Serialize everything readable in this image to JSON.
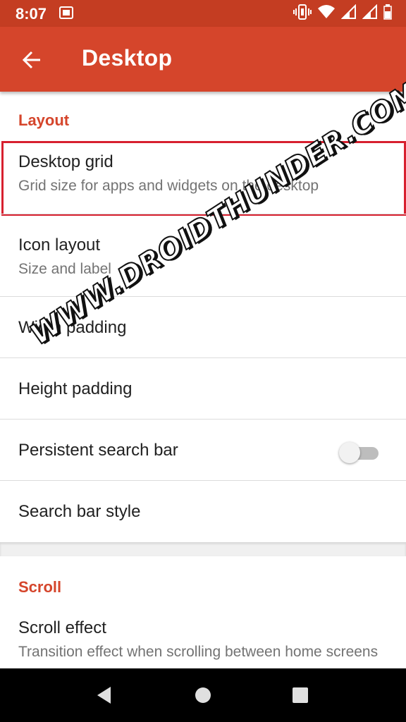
{
  "status_bar": {
    "time": "8:07",
    "icons": [
      "screenshot-icon",
      "vibrate-icon",
      "wifi-icon",
      "signal-icon",
      "signal-icon",
      "battery-icon"
    ]
  },
  "app_bar": {
    "title": "Desktop",
    "back_icon": "arrow-back-icon"
  },
  "sections": [
    {
      "header": "Layout",
      "items": [
        {
          "title": "Desktop grid",
          "summary": "Grid size for apps and widgets on the desktop",
          "highlighted": true
        },
        {
          "title": "Icon layout",
          "summary": "Size and label"
        },
        {
          "title": "Width padding"
        },
        {
          "title": "Height padding"
        },
        {
          "title": "Persistent search bar",
          "toggle": false
        },
        {
          "title": "Search bar style"
        }
      ]
    },
    {
      "header": "Scroll",
      "items": [
        {
          "title": "Scroll effect",
          "summary": "Transition effect when scrolling between home screens"
        }
      ]
    }
  ],
  "watermark": "WWW.DROIDTHUNDER.COM",
  "nav_bar": [
    "back-icon",
    "home-icon",
    "recents-icon"
  ],
  "colors": {
    "status_bar": "#c43d22",
    "app_bar": "#d5452b",
    "accent": "#d5452b",
    "highlight_border": "#d7202f"
  }
}
